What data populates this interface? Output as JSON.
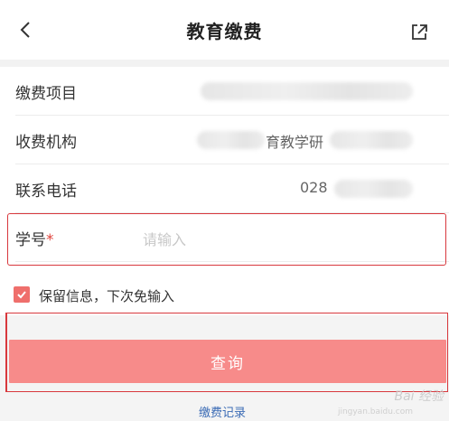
{
  "header": {
    "title": "教育缴费",
    "back_icon": "chevron-left-icon",
    "share_icon": "share-icon"
  },
  "form": {
    "fee_item": {
      "label": "缴费项目",
      "value": ""
    },
    "institution": {
      "label": "收费机构",
      "value_partial": "育教学研"
    },
    "phone": {
      "label": "联系电话",
      "value_prefix": "028"
    },
    "student_id": {
      "label": "学号",
      "required_mark": "*",
      "placeholder": "请输入"
    }
  },
  "remember": {
    "checked": true,
    "label": "保留信息，下次免输入"
  },
  "actions": {
    "query_label": "查询",
    "records_link": "缴费记录"
  },
  "watermark": {
    "text": "Bai 经验",
    "sub": "jingyan.baidu.com"
  },
  "colors": {
    "accent": "#f78b8a",
    "highlight": "#d8383d",
    "link": "#3b6bb5"
  }
}
